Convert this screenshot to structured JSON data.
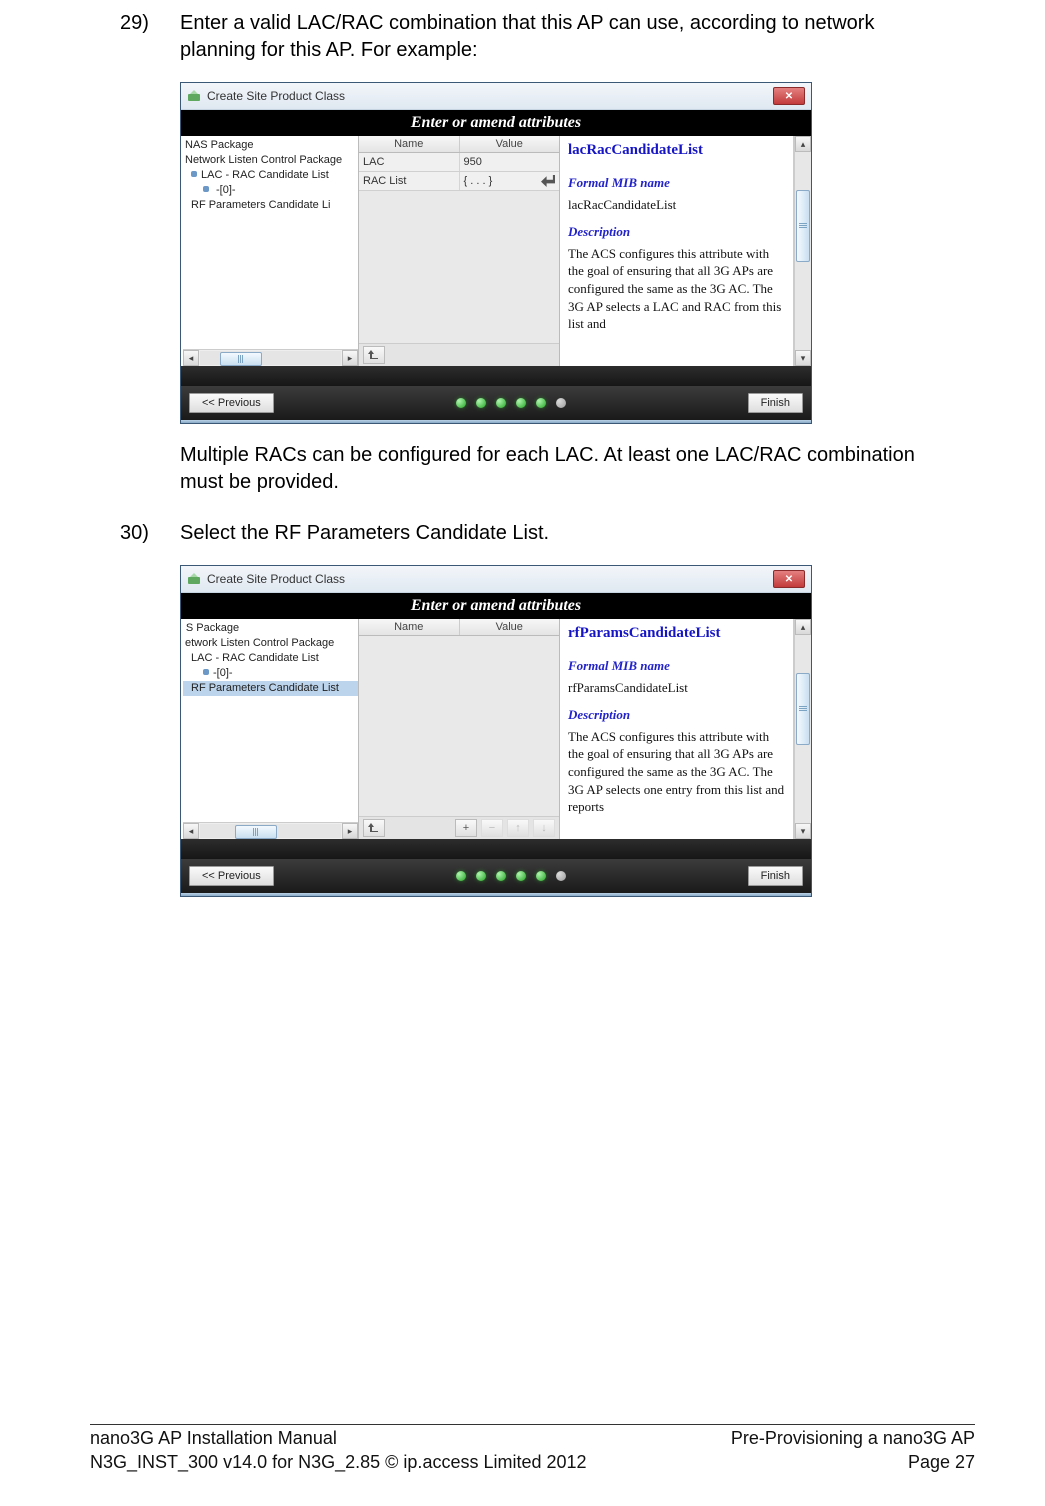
{
  "steps": {
    "s29_num": "29)",
    "s29_text": "Enter a valid LAC/RAC combination that this AP can use, according to network planning for this AP. For example:",
    "after29": "Multiple RACs can be configured for each LAC. At least one LAC/RAC combination must be provided.",
    "s30_num": "30)",
    "s30_text": "Select the RF Parameters Candidate List."
  },
  "win1": {
    "title": "Create Site Product Class",
    "blackbar": "Enter or amend attributes",
    "grid": {
      "h1": "Name",
      "h2": "Value",
      "r1c1": "LAC",
      "r1c2": "950",
      "r2c1": "RAC List",
      "r2c2": "{ . . . }"
    },
    "tree": {
      "t1": "NAS Package",
      "t2": "Network Listen Control Package",
      "t3": "LAC - RAC Candidate List",
      "t4": "-[0]-",
      "t5": "RF Parameters Candidate Li"
    },
    "info": {
      "title": "lacRacCandidateList",
      "sub1": "Formal MIB name",
      "plain1": "lacRacCandidateList",
      "sub2": "Description",
      "desc": "The ACS configures this attribute with the goal of ensuring that all 3G APs are configured the same as the 3G AC. The 3G AP selects a LAC and RAC from this list and"
    },
    "prev": "<< Previous",
    "finish": "Finish"
  },
  "win2": {
    "title": "Create Site Product Class",
    "blackbar": "Enter or amend attributes",
    "grid": {
      "h1": "Name",
      "h2": "Value"
    },
    "tree": {
      "t1": " S Package",
      "t2": "etwork Listen Control Package",
      "t3": "LAC - RAC Candidate List",
      "t4": "-[0]-",
      "t5": "RF Parameters Candidate List"
    },
    "info": {
      "title": "rfParamsCandidateList",
      "sub1": "Formal MIB name",
      "plain1": "rfParamsCandidateList",
      "sub2": "Description",
      "desc": "The ACS configures this attribute with the goal of ensuring that all 3G APs are configured the same as the 3G AC. The 3G AP selects one entry from this list and reports"
    },
    "prev": "<< Previous",
    "finish": "Finish"
  },
  "footer": {
    "left1": "nano3G AP Installation Manual",
    "left2": "N3G_INST_300 v14.0 for N3G_2.85 © ip.access Limited 2012",
    "right1": "Pre-Provisioning a nano3G AP",
    "right2": "Page 27"
  }
}
